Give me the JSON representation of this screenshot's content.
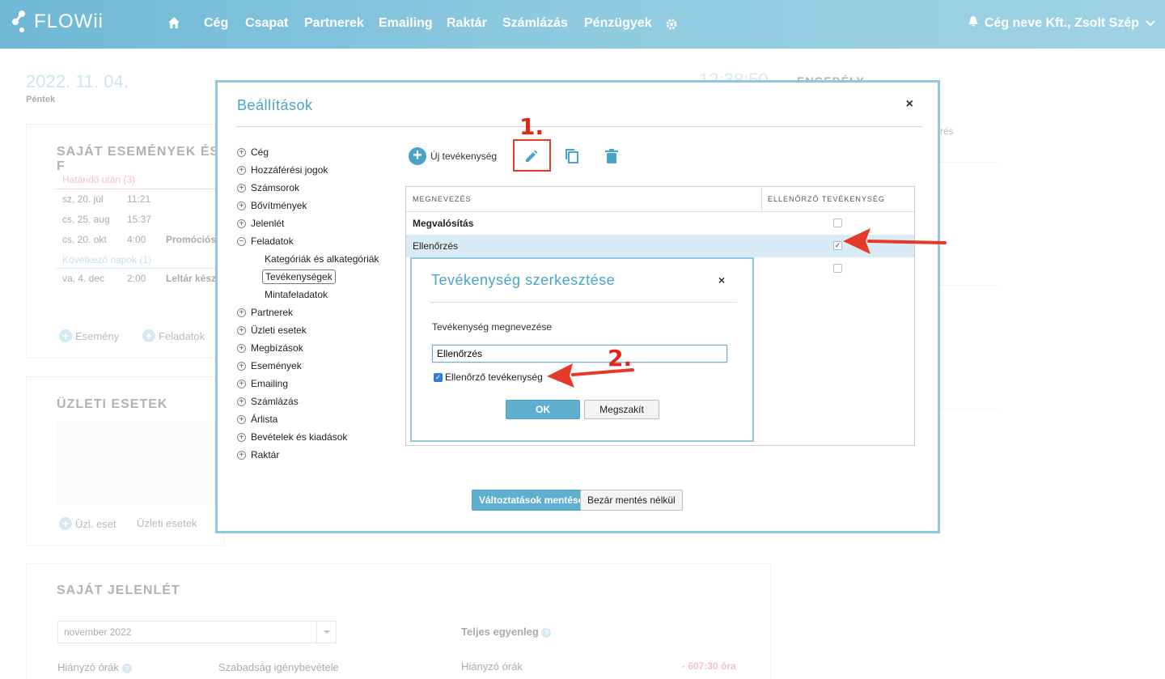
{
  "nav": {
    "logo": "FLOWii",
    "items": [
      "Cég",
      "Csapat",
      "Partnerek",
      "Emailing",
      "Raktár",
      "Számlázás",
      "Pénzügyek"
    ],
    "user": "Cég neve Kft., Zsolt Szép"
  },
  "dashboard": {
    "date": "2022. 11. 04.",
    "day": "Péntek",
    "clock": "12:38:50",
    "right_title": "ENGEDÉLY",
    "right_snippet": "rés",
    "events": {
      "title": "SAJÁT ESEMÉNYEK ÉS F",
      "group1": "Határidő után (3)",
      "rows1": [
        {
          "date": "sz, 20. júl",
          "time": "11:21",
          "text": ""
        },
        {
          "date": "cs, 25. aug",
          "time": "15:37",
          "text": ""
        },
        {
          "date": "cs, 20. okt",
          "time": "4:00",
          "text": "Promóciós"
        }
      ],
      "group2": "Következő napok (1)",
      "rows2": [
        {
          "date": "va, 4. dec",
          "time": "2:00",
          "text": "Leltár kész"
        }
      ],
      "add_event": "Esemény",
      "add_task": "Feladatok"
    },
    "deals": {
      "title": "ÜZLETI ESETEK",
      "add_deal": "Üzl. eset",
      "deals_link": "Üzleti esetek"
    },
    "attendance": {
      "title": "SAJÁT JELENLÉT",
      "month": "november 2022",
      "missing_hours": "Hiányzó órák",
      "leave": "Szabadság igénybevétele",
      "balance_title": "Teljes egyenleg",
      "balance_missing": "Hiányzó órák",
      "balance_value": "- 607:30 óra"
    }
  },
  "settings": {
    "title": "Beállítások",
    "close": "×",
    "tree": [
      {
        "label": "Cég",
        "icon": "plus"
      },
      {
        "label": "Hozzáférési jogok",
        "icon": "plus"
      },
      {
        "label": "Számsorok",
        "icon": "plus"
      },
      {
        "label": "Bővítmények",
        "icon": "plus"
      },
      {
        "label": "Jelenlét",
        "icon": "plus"
      },
      {
        "label": "Feladatok",
        "icon": "minus"
      }
    ],
    "subtree": [
      "Kategóriák és alkategóriák",
      "Tevékenységek",
      "Mintafeladatok"
    ],
    "tree2": [
      "Partnerek",
      "Üzleti esetek",
      "Megbízások",
      "Események",
      "Emailing",
      "Számlázás",
      "Árlista",
      "Bevételek és kiadások",
      "Raktár"
    ],
    "new_activity": "Új tevékenység",
    "step1": "1.",
    "step2": "2.",
    "columns": [
      "MEGNEVEZÉS",
      "ELLENŐRZŐ TEVÉKENYSÉG"
    ],
    "rows": [
      {
        "name": "Megvalósítás",
        "checked": false
      },
      {
        "name": "Ellenőrzés",
        "checked": true
      }
    ],
    "save": "Változtatások mentése",
    "close_nosave": "Bezár mentés nélkül"
  },
  "edit_dialog": {
    "title": "Tevékenység szerkesztése",
    "close": "×",
    "label": "Tevékenység megnevezése",
    "value": "Ellenőrzés",
    "checkbox": "Ellenőrző tevékenység",
    "ok": "OK",
    "cancel": "Megszakít"
  },
  "colors": {
    "accent": "#4aa3c8",
    "annotation": "#e53a2a"
  }
}
